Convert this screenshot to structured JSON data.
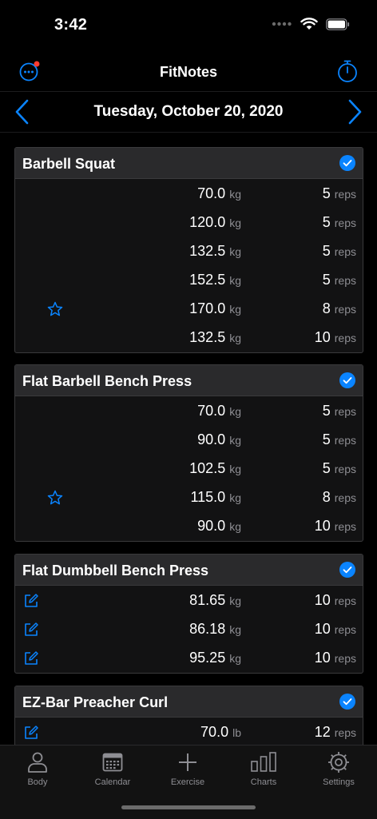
{
  "status": {
    "time": "3:42"
  },
  "header": {
    "title": "FitNotes"
  },
  "date": {
    "label": "Tuesday, October 20, 2020"
  },
  "colors": {
    "accent": "#0a84ff",
    "badge": "#ff3b30"
  },
  "exercises": [
    {
      "name": "Barbell Squat",
      "sets": [
        {
          "weight": "70.0",
          "unit": "kg",
          "reps": "5",
          "reps_unit": "reps",
          "marker": null
        },
        {
          "weight": "120.0",
          "unit": "kg",
          "reps": "5",
          "reps_unit": "reps",
          "marker": null
        },
        {
          "weight": "132.5",
          "unit": "kg",
          "reps": "5",
          "reps_unit": "reps",
          "marker": null
        },
        {
          "weight": "152.5",
          "unit": "kg",
          "reps": "5",
          "reps_unit": "reps",
          "marker": null
        },
        {
          "weight": "170.0",
          "unit": "kg",
          "reps": "8",
          "reps_unit": "reps",
          "marker": "star-icon"
        },
        {
          "weight": "132.5",
          "unit": "kg",
          "reps": "10",
          "reps_unit": "reps",
          "marker": null
        }
      ]
    },
    {
      "name": "Flat Barbell Bench Press",
      "sets": [
        {
          "weight": "70.0",
          "unit": "kg",
          "reps": "5",
          "reps_unit": "reps",
          "marker": null
        },
        {
          "weight": "90.0",
          "unit": "kg",
          "reps": "5",
          "reps_unit": "reps",
          "marker": null
        },
        {
          "weight": "102.5",
          "unit": "kg",
          "reps": "5",
          "reps_unit": "reps",
          "marker": null
        },
        {
          "weight": "115.0",
          "unit": "kg",
          "reps": "8",
          "reps_unit": "reps",
          "marker": "star-icon"
        },
        {
          "weight": "90.0",
          "unit": "kg",
          "reps": "10",
          "reps_unit": "reps",
          "marker": null
        }
      ]
    },
    {
      "name": "Flat Dumbbell Bench Press",
      "sets": [
        {
          "weight": "81.65",
          "unit": "kg",
          "reps": "10",
          "reps_unit": "reps",
          "marker": "note-icon"
        },
        {
          "weight": "86.18",
          "unit": "kg",
          "reps": "10",
          "reps_unit": "reps",
          "marker": "note-icon"
        },
        {
          "weight": "95.25",
          "unit": "kg",
          "reps": "10",
          "reps_unit": "reps",
          "marker": "note-icon"
        }
      ]
    },
    {
      "name": "EZ-Bar Preacher Curl",
      "sets": [
        {
          "weight": "70.0",
          "unit": "lb",
          "reps": "12",
          "reps_unit": "reps",
          "marker": "note-icon"
        }
      ]
    }
  ],
  "tabs": [
    {
      "label": "Body",
      "icon": "person-icon"
    },
    {
      "label": "Calendar",
      "icon": "calendar-icon"
    },
    {
      "label": "Exercise",
      "icon": "plus-icon"
    },
    {
      "label": "Charts",
      "icon": "bar-chart-icon"
    },
    {
      "label": "Settings",
      "icon": "gear-icon"
    }
  ]
}
